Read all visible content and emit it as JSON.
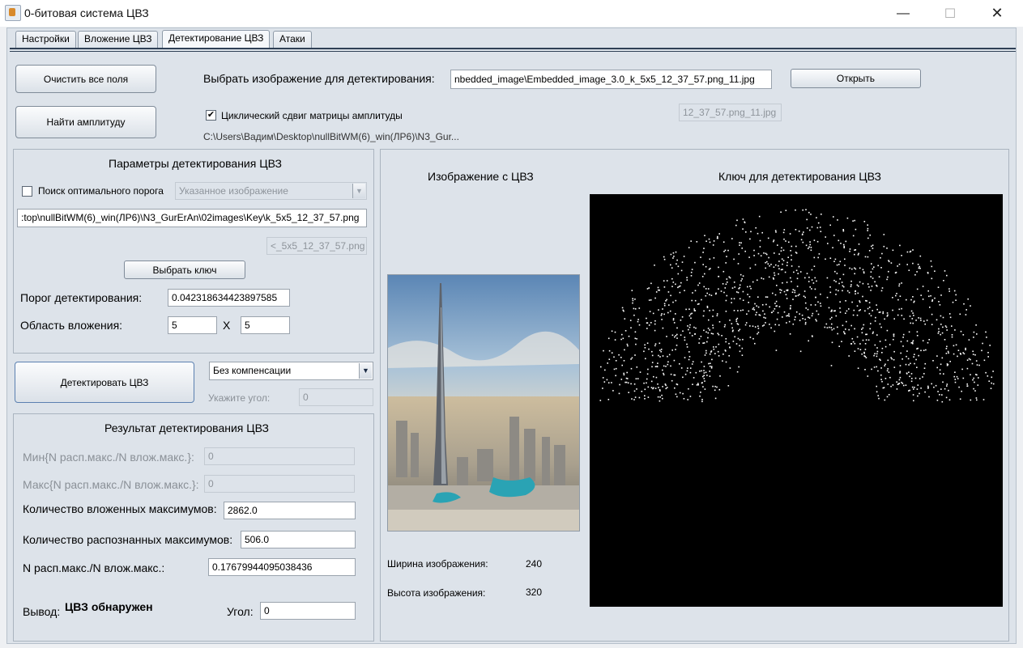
{
  "window": {
    "title": "0-битовая система ЦВЗ",
    "minimize": "—",
    "maximize": "☐",
    "close": "✕"
  },
  "tabs": [
    {
      "label": "Настройки"
    },
    {
      "label": "Вложение ЦВЗ"
    },
    {
      "label": "Детектирование ЦВЗ",
      "active": true
    },
    {
      "label": "Атаки"
    }
  ],
  "top": {
    "clear_button": "Очистить все поля",
    "find_amplitude_button": "Найти амплитуду",
    "select_image_label": "Выбрать изображение для детектирования:",
    "image_path_value": "nbedded_image\\Embedded_image_3.0_k_5x5_12_37_57.png_11.jpg",
    "open_button": "Открыть",
    "image_filename_hint": "12_37_57.png_11.jpg",
    "cyclic_shift_checkbox": "Циклический сдвиг матрицы амплитуды",
    "cyclic_shift_checked": true,
    "directory_path": "C:\\Users\\Вадим\\Desktop\\nullBitWM(6)_win(ЛР6)\\N3_Gur..."
  },
  "params": {
    "title": "Параметры детектирования ЦВЗ",
    "optimal_threshold_checkbox": "Поиск оптимального порога",
    "optimal_threshold_checked": false,
    "source_select_value": "Указанное изображение",
    "key_path_value": ":top\\nullBitWM(6)_win(ЛР6)\\N3_GurErAn\\02images\\Key\\k_5x5_12_37_57.png",
    "key_filename_hint": "<_5x5_12_37_57.png",
    "select_key_button": "Выбрать ключ",
    "threshold_label": "Порог детектирования:",
    "threshold_value": "0.042318634423897585",
    "region_label": "Область вложения:",
    "region_w": "5",
    "region_x": "X",
    "region_h": "5"
  },
  "detect": {
    "detect_button": "Детектировать ЦВЗ",
    "compensation_value": "Без компенсации",
    "angle_prompt_label": "Укажите угол:",
    "angle_prompt_value": "0"
  },
  "result": {
    "title": "Результат детектирования ЦВЗ",
    "min_label": "Мин{N расп.макс./N влож.макс.}:",
    "min_value": "0",
    "max_label": "Макс{N расп.макс./N влож.макс.}:",
    "max_value": "0",
    "embedded_count_label": "Количество вложенных максимумов:",
    "embedded_count_value": "2862.0",
    "recognized_count_label": "Количество распознанных максимумов:",
    "recognized_count_value": "506.0",
    "ratio_label": "N расп.макс./N влож.макс.:",
    "ratio_value": "0.17679944095038436",
    "output_label": "Вывод:",
    "output_value": "ЦВЗ обнаружен",
    "angle_label": "Угол:",
    "angle_value": "0"
  },
  "preview": {
    "image_title": "Изображение с ЦВЗ",
    "key_title": "Ключ для детектирования ЦВЗ",
    "width_label": "Ширина изображения:",
    "width_value": "240",
    "height_label": "Высота изображения:",
    "height_value": "320"
  },
  "colors": {
    "accent_dark": "#2e3f55",
    "key_background": "#000000"
  }
}
